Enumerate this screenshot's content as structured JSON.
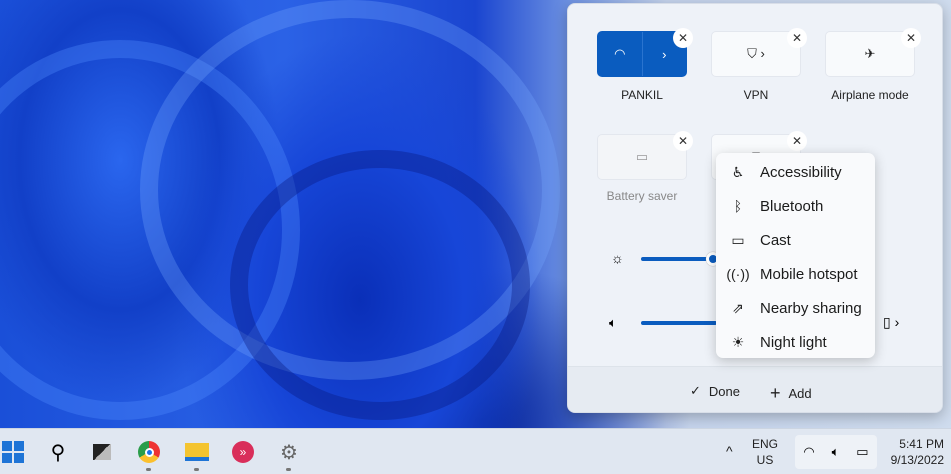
{
  "quick_settings": {
    "tiles": [
      {
        "label": "PANKIL",
        "icon": "wifi-icon",
        "active": true
      },
      {
        "label": "VPN",
        "icon": "shield-icon",
        "active": false
      },
      {
        "label": "Airplane mode",
        "icon": "airplane-icon",
        "active": false
      },
      {
        "label": "Battery saver",
        "icon": "battery-saver-icon",
        "active": false,
        "disabled": true
      },
      {
        "label": "",
        "icon": "project-icon",
        "active": false
      }
    ],
    "brightness_percent": 40,
    "volume_percent": 42,
    "footer": {
      "done": "Done",
      "add": "Add"
    },
    "accent_color": "#0a5cbf"
  },
  "add_menu": {
    "items": [
      {
        "label": "Accessibility",
        "icon": "accessibility-icon"
      },
      {
        "label": "Bluetooth",
        "icon": "bluetooth-icon"
      },
      {
        "label": "Cast",
        "icon": "cast-icon"
      },
      {
        "label": "Mobile hotspot",
        "icon": "hotspot-icon"
      },
      {
        "label": "Nearby sharing",
        "icon": "nearby-sharing-icon"
      },
      {
        "label": "Night light",
        "icon": "night-light-icon"
      }
    ]
  },
  "taskbar": {
    "lang_top": "ENG",
    "lang_bottom": "US",
    "time": "5:41 PM",
    "date": "9/13/2022"
  }
}
